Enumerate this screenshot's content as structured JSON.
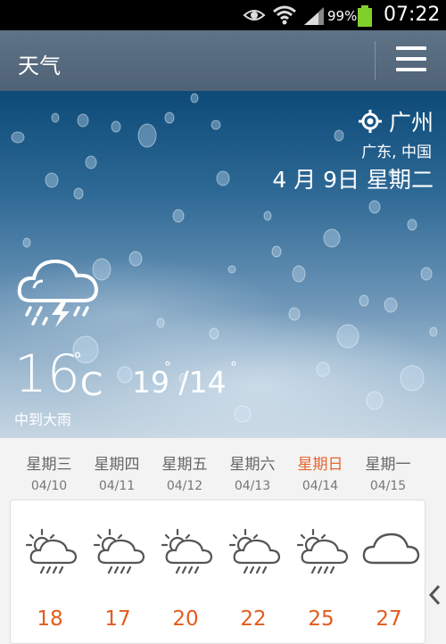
{
  "status_bar": {
    "battery_percent": "99%",
    "time": "07:22",
    "icons": [
      "eye-icon",
      "wifi-icon",
      "signal-icon",
      "battery-icon"
    ]
  },
  "header": {
    "title": "天气",
    "menu_icon": "menu-icon"
  },
  "location": {
    "city": "广州",
    "region": "广东, 中国",
    "date": "4 月 9日 星期二"
  },
  "current": {
    "temp": "16",
    "deg": "°",
    "unit": "C",
    "high_low": "19 /14",
    "condition": "中到大雨",
    "icon": "thunder-rain-cloud-icon"
  },
  "forecast": [
    {
      "day": "星期三",
      "date": "04/10",
      "high": "18",
      "icon": "partly-sunny-rain-icon",
      "weekend": false
    },
    {
      "day": "星期四",
      "date": "04/11",
      "high": "17",
      "icon": "partly-sunny-rain-icon",
      "weekend": false
    },
    {
      "day": "星期五",
      "date": "04/12",
      "high": "20",
      "icon": "partly-sunny-rain-icon",
      "weekend": false
    },
    {
      "day": "星期六",
      "date": "04/13",
      "high": "22",
      "icon": "partly-sunny-rain-icon",
      "weekend": false
    },
    {
      "day": "星期日",
      "date": "04/14",
      "high": "25",
      "icon": "partly-sunny-rain-icon",
      "weekend": true
    },
    {
      "day": "星期一",
      "date": "04/15",
      "high": "27",
      "icon": "cloudy-icon",
      "weekend": false
    }
  ],
  "colors": {
    "accent": "#e35b1d",
    "weekend": "#e5662e",
    "actionbar": "#56697d"
  }
}
